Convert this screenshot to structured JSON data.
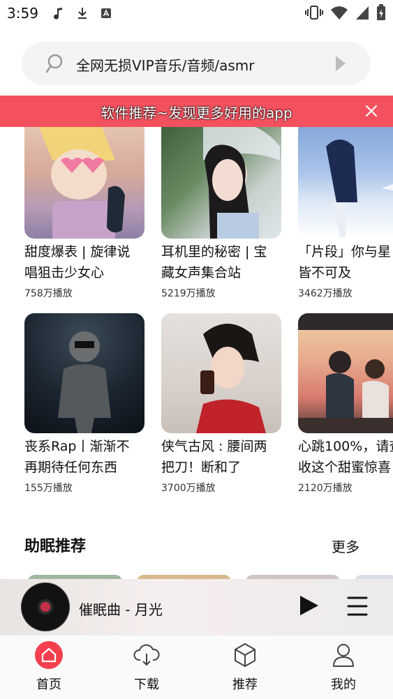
{
  "status_bar": {
    "time": "3:59"
  },
  "search": {
    "placeholder_text": "全网无损VIP音乐/音频/asmr"
  },
  "banner": {
    "text": "软件推荐~发现更多好用的app"
  },
  "cards": [
    {
      "title": "甜度爆表 | 旋律说唱狙击少女心",
      "line1": "甜度爆表 | 旋律说",
      "line2": "唱狙击少女心",
      "plays": "758万播放"
    },
    {
      "title": "耳机里的秘密 | 宝藏女声集合站",
      "line1": "耳机里的秘密 | 宝",
      "line2": "藏女声集合站",
      "plays": "5219万播放"
    },
    {
      "title": "「片段」你与星皆不可及",
      "line1": "「片段」你与星",
      "line2": "皆不可及",
      "plays": "3462万播放"
    },
    {
      "title": "丧系Rap丨渐渐不再期待任何东西",
      "line1": "丧系Rap丨渐渐不",
      "line2": "再期待任何东西",
      "plays": "155万播放"
    },
    {
      "title": "侠气古风 : 腰间两把刀！断和了",
      "line1": "侠气古风 : 腰间两",
      "line2": "把刀！断和了",
      "plays": "3700万播放"
    },
    {
      "title": "心跳100%，请查收这个甜蜜惊喜",
      "line1": "心跳100%，请查",
      "line2": "收这个甜蜜惊喜",
      "plays": "2120万播放"
    }
  ],
  "section": {
    "title": "助眠推荐",
    "more": "更多"
  },
  "player": {
    "track": "催眠曲 - 月光"
  },
  "nav": {
    "home": "首页",
    "download": "下载",
    "recommend": "推荐",
    "mine": "我的"
  },
  "colors": {
    "accent": "#f4404e",
    "banner": "#f4515f"
  }
}
